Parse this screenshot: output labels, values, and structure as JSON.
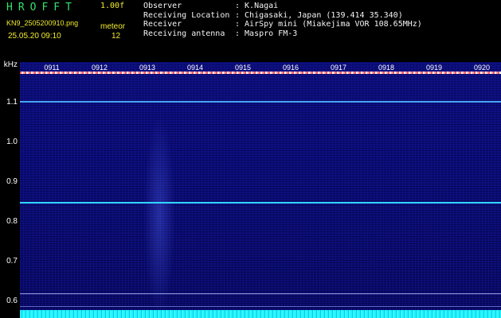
{
  "header": {
    "logo": "HROFFT",
    "version": "1.00f",
    "file_name": "KN9_2505200910.png",
    "program": "meteor",
    "date_time": "25.05.20 09:10",
    "count": "12",
    "meta": [
      {
        "label": "Observer",
        "value": ": K.Nagai"
      },
      {
        "label": "Receiving Location",
        "value": ": Chigasaki, Japan (139.414 35.340)"
      },
      {
        "label": "Receiver",
        "value": ": AirSpy mini (Miakejima VOR 108.65MHz)"
      },
      {
        "label": "Receiving antenna",
        "value": ": Maspro FM-3"
      }
    ]
  },
  "spectrogram": {
    "unit": "kHz",
    "y_labels": [
      "1.1",
      "1.0",
      "0.9",
      "0.8",
      "0.7",
      "0.6"
    ],
    "time_labels": [
      "0911",
      "0912",
      "0913",
      "0914",
      "0915",
      "0916",
      "0917",
      "0918",
      "0919",
      "0920"
    ]
  },
  "colors": {
    "background": "#0a0c78",
    "logo": "#32e36a",
    "info_text": "#f2ec2d",
    "bright_line": "#2fd6ff"
  }
}
